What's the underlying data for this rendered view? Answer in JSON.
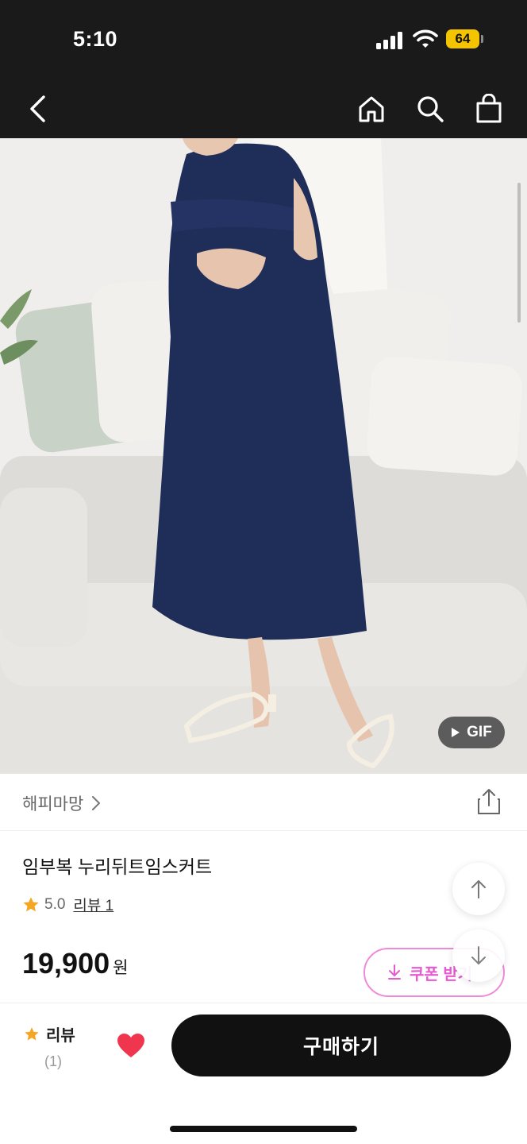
{
  "status_bar": {
    "time": "5:10",
    "battery": "64",
    "icons": [
      "signal-icon",
      "wifi-icon",
      "battery-icon"
    ]
  },
  "nav": {
    "icons": [
      "back-icon",
      "home-icon",
      "search-icon",
      "shopping-bag-icon"
    ]
  },
  "hero": {
    "gif_label": "GIF",
    "icons": [
      "play-icon"
    ]
  },
  "brand": {
    "name": "해피마망",
    "icons": [
      "chevron-right-icon",
      "share-icon"
    ]
  },
  "product": {
    "title": "임부복 누리뒤트임스커트",
    "rating": "5.0",
    "review_link": "리뷰 1",
    "price": "19,900",
    "currency": "원",
    "coupon_label": "쿠폰 받기"
  },
  "floating": {
    "icons": [
      "arrow-up-icon",
      "arrow-down-icon"
    ]
  },
  "bottom_bar": {
    "review_label": "리뷰",
    "review_count": "(1)",
    "buy_label": "구매하기",
    "icons": [
      "star-icon",
      "heart-icon"
    ]
  },
  "colors": {
    "status_bar_bg": "#1a1a1a",
    "accent_pink": "#e55ad0",
    "star": "#f5a623",
    "heart": "#f0364e",
    "buy_button_bg": "#111111"
  }
}
